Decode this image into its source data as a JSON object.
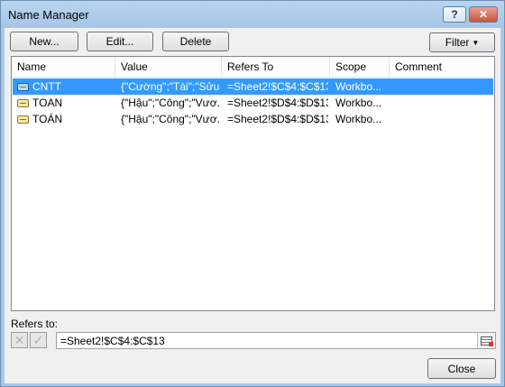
{
  "window": {
    "title": "Name Manager"
  },
  "titlebar": {
    "help_label": "?",
    "close_label": "✕"
  },
  "toolbar": {
    "new_label": "New...",
    "edit_label": "Edit...",
    "delete_label": "Delete",
    "filter_label": "Filter"
  },
  "table": {
    "columns": [
      "Name",
      "Value",
      "Refers To",
      "Scope",
      "Comment"
    ],
    "rows": [
      {
        "name": "CNTT",
        "value": "{\"Cường\";\"Tài\";\"Sửu...",
        "refers_to": "=Sheet2!$C$4:$C$13",
        "scope": "Workbo...",
        "comment": "",
        "selected": true
      },
      {
        "name": "TOAN",
        "value": "{\"Hậu\";\"Công\";\"Vươ...",
        "refers_to": "=Sheet2!$D$4:$D$13",
        "scope": "Workbo...",
        "comment": "",
        "selected": false
      },
      {
        "name": "TOÁN",
        "value": "{\"Hậu\";\"Công\";\"Vươ...",
        "refers_to": "=Sheet2!$D$4:$D$13",
        "scope": "Workbo...",
        "comment": "",
        "selected": false
      }
    ]
  },
  "refers": {
    "label": "Refers to:",
    "value": "=Sheet2!$C$4:$C$13"
  },
  "footer": {
    "close_label": "Close"
  },
  "colors": {
    "title_bar": "#a9c8e8",
    "selection": "#3399ff",
    "dialog_bg": "#f0f0f0"
  },
  "icons": [
    "help-icon",
    "close-icon",
    "name-icon",
    "cancel-x-icon",
    "check-icon",
    "collapse-dialog-icon"
  ]
}
